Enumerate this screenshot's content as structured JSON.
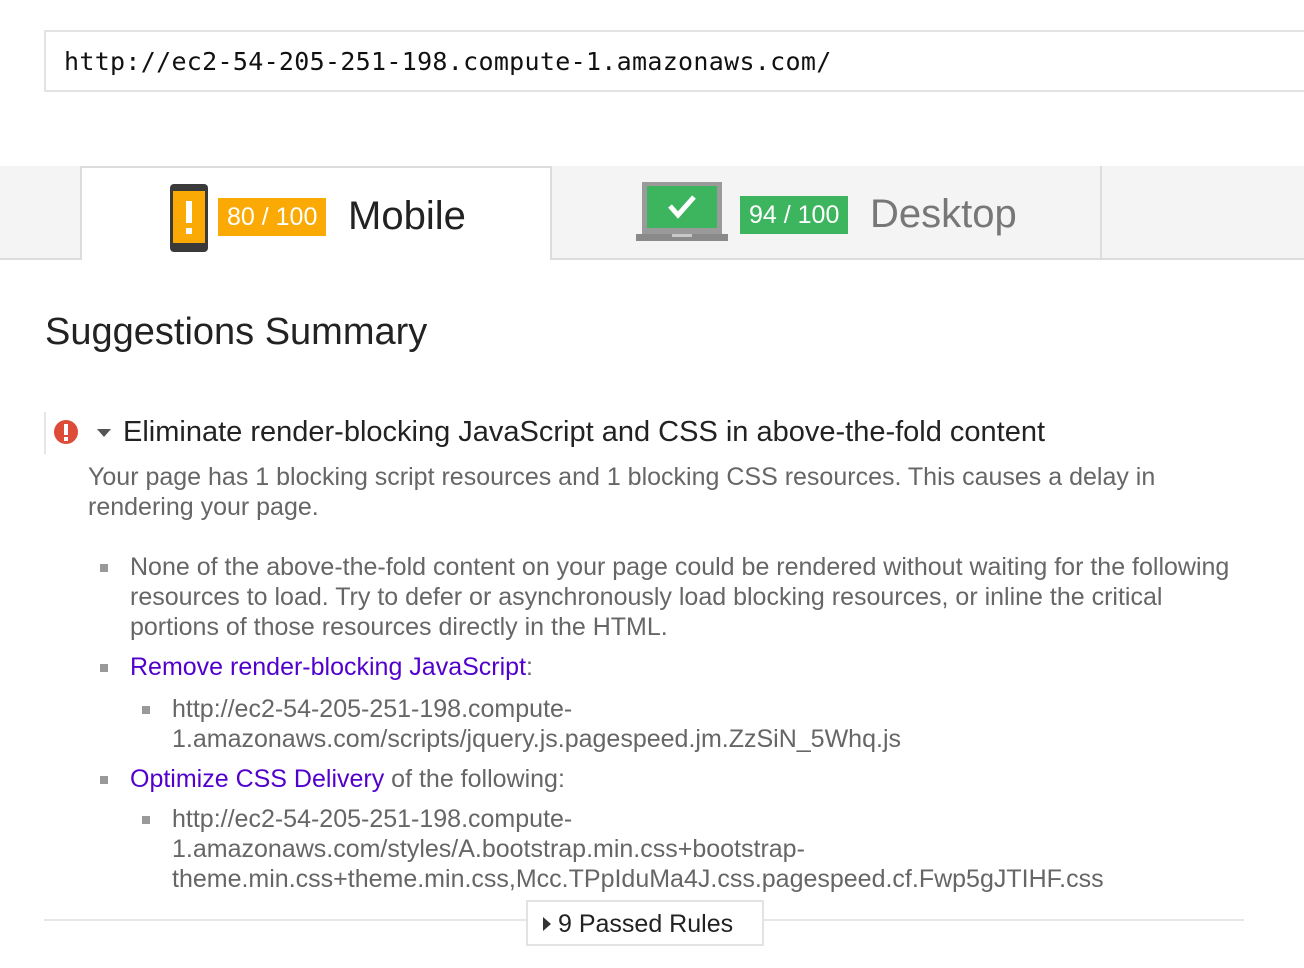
{
  "url_input": {
    "value": "http://ec2-54-205-251-198.compute-1.amazonaws.com/"
  },
  "tabs": [
    {
      "label": "Mobile",
      "score": "80 / 100",
      "color": "#fbaa05",
      "icon": "mobile-warning-icon"
    },
    {
      "label": "Desktop",
      "score": "94 / 100",
      "color": "#3cb55e",
      "icon": "laptop-check-icon"
    }
  ],
  "summary": {
    "title": "Suggestions Summary"
  },
  "rule": {
    "icon": "error-icon",
    "title": "Eliminate render-blocking JavaScript and CSS in above-the-fold content",
    "description": "Your page has 1 blocking script resources and 1 blocking CSS resources. This causes a delay in rendering your page.",
    "items": [
      {
        "text": "None of the above-the-fold content on your page could be rendered without waiting for the following resources to load. Try to defer or asynchronously load blocking resources, or inline the critical portions of those resources directly in the HTML."
      },
      {
        "link": "Remove render-blocking JavaScript",
        "suffix": ":",
        "resources": [
          "http://ec2-54-205-251-198.compute-1.amazonaws.com/scripts/jquery.js.pagespeed.jm.ZzSiN_5Whq.js"
        ]
      },
      {
        "link": "Optimize CSS Delivery",
        "suffix": " of the following:",
        "resources": [
          "http://ec2-54-205-251-198.compute-1.amazonaws.com/styles/A.bootstrap.min.css+bootstrap-theme.min.css+theme.min.css,Mcc.TPpIduMa4J.css.pagespeed.cf.Fwp5gJTIHF.css"
        ]
      }
    ]
  },
  "passed_rules": {
    "label": "9 Passed Rules"
  },
  "colors": {
    "link": "#5200cc",
    "error": "#dd4b39",
    "mobile_score": "#fbaa05",
    "desktop_score": "#3cb55e"
  }
}
